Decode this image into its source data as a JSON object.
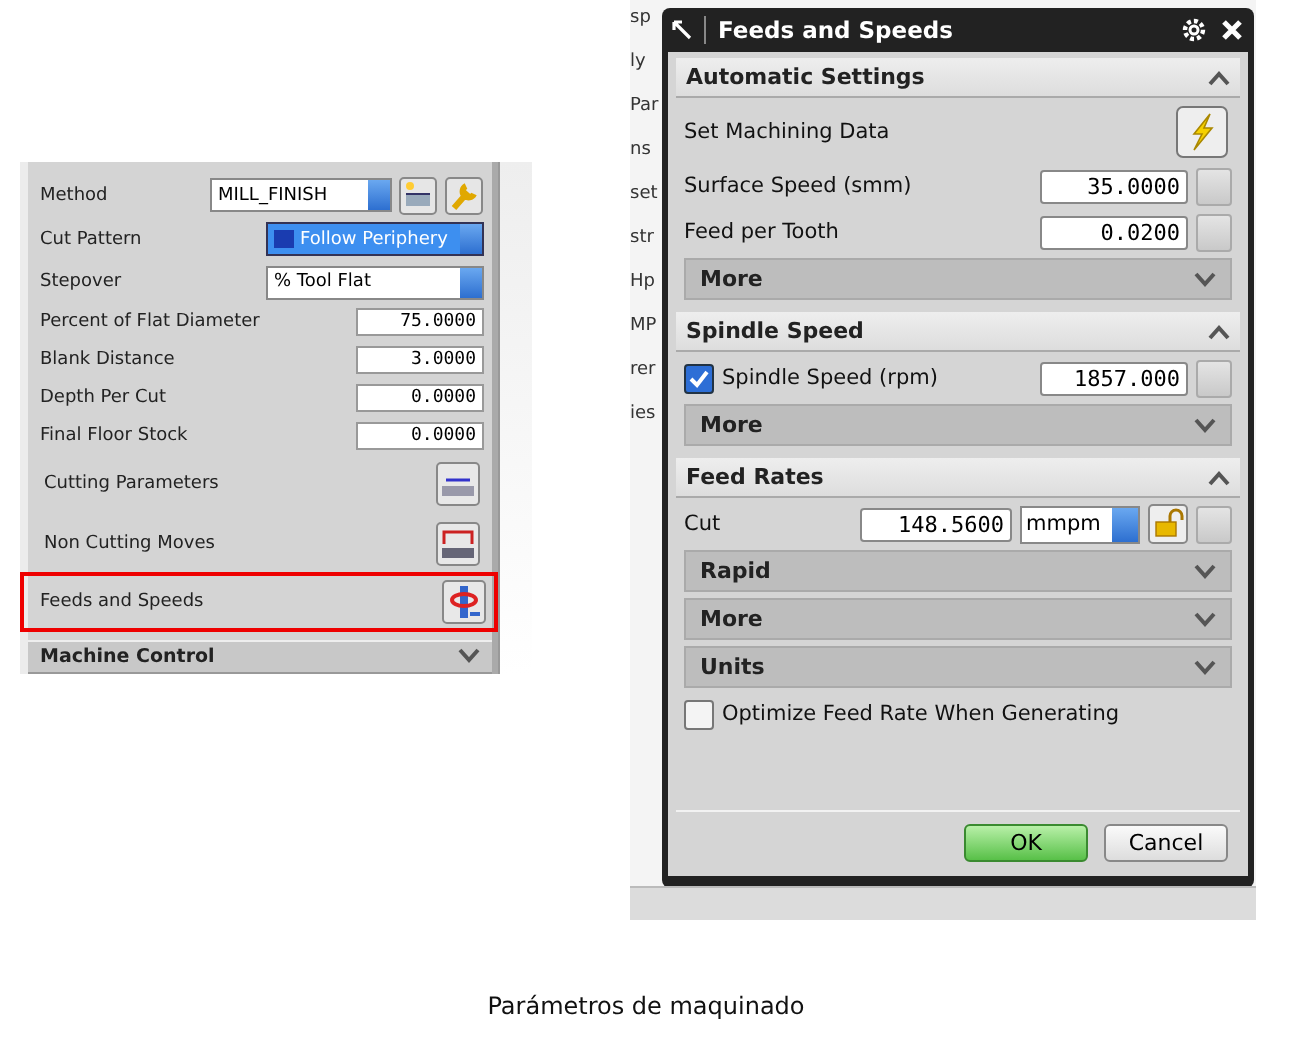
{
  "method_panel": {
    "method": {
      "label": "Method",
      "value": "MILL_FINISH"
    },
    "cut_pattern": {
      "label": "Cut Pattern",
      "value": "Follow Periphery"
    },
    "stepover": {
      "label": "Stepover",
      "value": "% Tool Flat"
    },
    "numeric_fields": [
      {
        "label": "Percent of Flat Diameter",
        "value": "75.0000"
      },
      {
        "label": "Blank Distance",
        "value": "3.0000"
      },
      {
        "label": "Depth Per Cut",
        "value": "0.0000"
      },
      {
        "label": "Final Floor Stock",
        "value": "0.0000"
      }
    ],
    "action_rows": [
      {
        "kind": "cutting",
        "label": "Cutting Parameters",
        "highlighted": false
      },
      {
        "kind": "non_cutting",
        "label": "Non Cutting Moves",
        "highlighted": false
      },
      {
        "kind": "feeds",
        "label": "Feeds and Speeds",
        "highlighted": true
      }
    ],
    "sections": [
      {
        "label": "Machine Control",
        "expanded": false
      }
    ]
  },
  "background_fragments": [
    "sp",
    "ly",
    "Par",
    "ns",
    "set",
    "str",
    "Hp",
    "MP",
    "rer",
    "ies"
  ],
  "dialog": {
    "title": "Feeds and Speeds",
    "automatic_settings": {
      "title": "Automatic Settings",
      "expanded": true,
      "set_machining_data": "Set Machining Data",
      "fields": [
        {
          "label": "Surface Speed (smm)",
          "value": "35.0000"
        },
        {
          "label": "Feed per Tooth",
          "value": "0.0200"
        }
      ],
      "more": {
        "label": "More",
        "expanded": false
      }
    },
    "spindle_speed": {
      "title": "Spindle Speed",
      "expanded": true,
      "label": "Spindle Speed (rpm)",
      "checked": true,
      "value": "1857.000",
      "more": {
        "label": "More",
        "expanded": false
      }
    },
    "feed_rates": {
      "title": "Feed Rates",
      "expanded": true,
      "cut_label": "Cut",
      "cut_value": "148.5600",
      "unit": "mmpm",
      "locked": false,
      "subsections": [
        {
          "label": "Rapid",
          "expanded": false
        },
        {
          "label": "More",
          "expanded": false
        },
        {
          "label": "Units",
          "expanded": false
        }
      ],
      "optimize": {
        "label": "Optimize Feed Rate When Generating",
        "checked": false
      }
    },
    "buttons": [
      {
        "label": "OK",
        "primary": true
      },
      {
        "label": "Cancel",
        "primary": false
      }
    ]
  },
  "caption": "Parámetros de maquinado"
}
